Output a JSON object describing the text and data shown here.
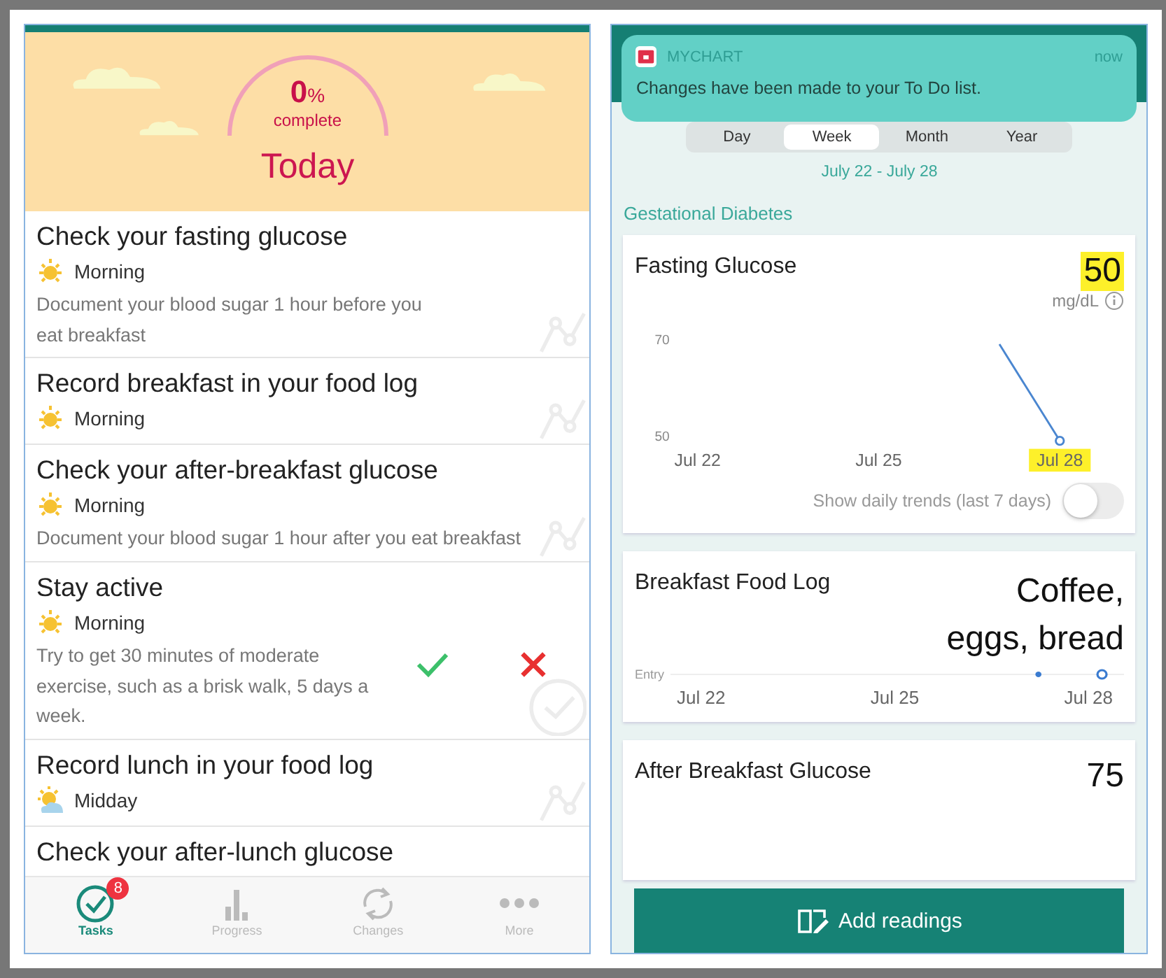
{
  "tasks_screen": {
    "header": {
      "percent": "0",
      "percent_sign": "%",
      "caption": "complete",
      "title": "Today"
    },
    "tasks": [
      {
        "kind": "tracking",
        "title": "Check your fasting glucose",
        "time": {
          "kind": "sun",
          "label": "Morning"
        },
        "description": "Document your blood sugar 1 hour before you eat breakfast",
        "show_actions": false
      },
      {
        "kind": "tracking",
        "title": "Record breakfast in your food log",
        "time": {
          "kind": "sun",
          "label": "Morning"
        },
        "show_actions": false
      },
      {
        "kind": "tracking",
        "title": "Check your after-breakfast glucose",
        "time": {
          "kind": "sun",
          "label": "Morning"
        },
        "description": "Document your blood sugar 1 hour after you eat breakfast",
        "show_actions": false
      },
      {
        "kind": "habit",
        "title": "Stay active",
        "time": {
          "kind": "sun",
          "label": "Morning"
        },
        "description": "Try to get 30 minutes of moderate exercise, such as a brisk walk, 5 days a week.",
        "show_actions": true
      },
      {
        "kind": "tracking",
        "title": "Record lunch in your food log",
        "time": {
          "kind": "cloud",
          "label": "Midday"
        },
        "show_actions": false
      },
      {
        "kind": "plain",
        "title": "Check your after-lunch glucose",
        "show_actions": false
      }
    ],
    "tab_bar": [
      {
        "kind": "tasks",
        "label": "Tasks",
        "selected": true,
        "badge": "8"
      },
      {
        "kind": "progress",
        "label": "Progress",
        "selected": false
      },
      {
        "kind": "changes",
        "label": "Changes",
        "selected": false
      },
      {
        "kind": "more",
        "label": "More",
        "selected": false
      }
    ]
  },
  "progress_screen": {
    "notification": {
      "app": "MYCHART",
      "time": "now",
      "message": "Changes have been made to your To Do list."
    },
    "range_tabs": [
      {
        "label": "Day",
        "selected": false
      },
      {
        "label": "Week",
        "selected": true
      },
      {
        "label": "Month",
        "selected": false
      },
      {
        "label": "Year",
        "selected": false
      }
    ],
    "date_range": "July 22 - July 28",
    "section": "Gestational Diabetes",
    "fasting_card": {
      "title": "Fasting Glucose",
      "value": "50",
      "value_highlighted": true,
      "unit": "mg/dL",
      "last_tick_highlighted": true,
      "chart_data": {
        "type": "line",
        "categories": [
          "Jul 22",
          null,
          null,
          "Jul 25",
          null,
          null,
          "Jul 28"
        ],
        "series": [
          {
            "color": "#4a86d0",
            "values": [
              null,
              null,
              null,
              null,
              null,
              70,
              50
            ]
          }
        ],
        "ylim": [
          50,
          70
        ],
        "yticks": [
          50,
          70
        ]
      },
      "toggle_label": "Show daily trends (last 7 days)",
      "toggle_on": false
    },
    "food_card": {
      "title": "Breakfast Food Log",
      "value": "Coffee, eggs, bread",
      "row_label": "Entry",
      "x_labels": [
        "Jul 22",
        "Jul 25",
        "Jul 28"
      ]
    },
    "after_card": {
      "title": "After Breakfast Glucose",
      "value": "75"
    },
    "add_button": "Add readings"
  }
}
